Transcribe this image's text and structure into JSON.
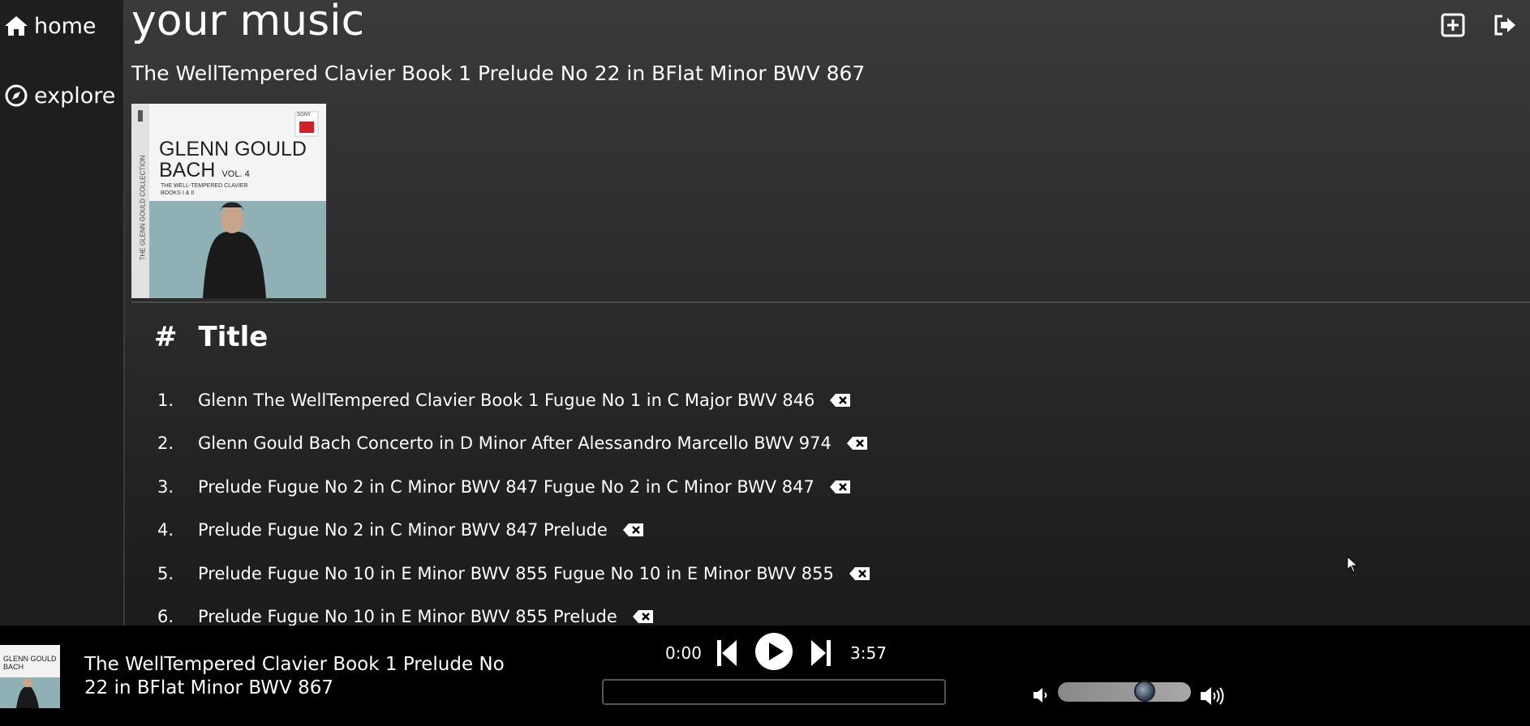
{
  "sidebar": {
    "items": [
      {
        "label": "home",
        "icon": "home-icon"
      },
      {
        "label": "explore",
        "icon": "compass-icon"
      }
    ]
  },
  "main": {
    "page_title": "your music",
    "album_title": "The WellTempered Clavier Book 1 Prelude No 22 in BFlat Minor BWV 867",
    "cover": {
      "line1": "GLENN GOULD",
      "line2": "BACH",
      "vol": "VOL. 4",
      "sub1": "THE WELL-TEMPERED CLAVIER",
      "sub2": "BOOKS I & II",
      "side": "THE GLENN GOULD COLLECTION",
      "label": "SONY"
    },
    "table_header": {
      "num": "#",
      "title": "Title"
    },
    "tracks": [
      {
        "num": "1.",
        "title": "Glenn The WellTempered Clavier Book 1 Fugue No 1 in C Major BWV 846"
      },
      {
        "num": "2.",
        "title": "Glenn Gould Bach Concerto in D Minor After Alessandro Marcello BWV 974"
      },
      {
        "num": "3.",
        "title": "Prelude Fugue No 2 in C Minor BWV 847 Fugue No 2 in C Minor BWV 847"
      },
      {
        "num": "4.",
        "title": "Prelude Fugue No 2 in C Minor BWV 847 Prelude"
      },
      {
        "num": "5.",
        "title": "Prelude Fugue No 10 in E Minor BWV 855 Fugue No 10 in E Minor BWV 855"
      },
      {
        "num": "6.",
        "title": "Prelude Fugue No 10 in E Minor BWV 855 Prelude"
      }
    ]
  },
  "player": {
    "now_playing": "The WellTempered Clavier Book 1 Prelude No 22 in BFlat Minor BWV 867",
    "time_current": "0:00",
    "time_total": "3:57",
    "progress": 0,
    "volume": 0.68
  }
}
